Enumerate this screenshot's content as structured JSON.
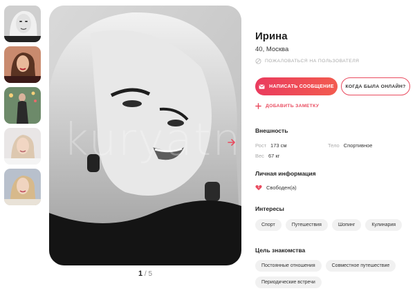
{
  "gallery": {
    "thumbnails": [
      "thumb-1",
      "thumb-2",
      "thumb-3",
      "thumb-4",
      "thumb-5"
    ],
    "watermark": "kuryatnik",
    "counter_current": "1",
    "counter_separator": "/",
    "counter_total": "5"
  },
  "profile": {
    "name": "Ирина",
    "age_city": "40, Москва",
    "report_label": "ПОЖАЛОВАТЬСЯ НА ПОЛЬЗОВАТЕЛЯ",
    "send_message_label": "НАПИСАТЬ СООБЩЕНИЕ",
    "last_online_label": "КОГДА БЫЛА ОНЛАЙН?",
    "add_note_label": "ДОБАВИТЬ ЗАМЕТКУ"
  },
  "appearance": {
    "title": "Внешность",
    "height_label": "Рост",
    "height_value": "173 см",
    "body_label": "Тело",
    "body_value": "Спортивное",
    "weight_label": "Вес",
    "weight_value": "67 кг"
  },
  "personal": {
    "title": "Личная информация",
    "status": "Свободен(а)"
  },
  "interests": {
    "title": "Интересы",
    "items": [
      "Спорт",
      "Путешествия",
      "Шопинг",
      "Кулинария"
    ]
  },
  "goal": {
    "title": "Цель знакомства",
    "items": [
      "Постоянные отношения",
      "Совместное путешествие",
      "Периодические встречи"
    ]
  },
  "colors": {
    "accent": "#e94b5f",
    "chip_bg": "#f1f1f1"
  }
}
